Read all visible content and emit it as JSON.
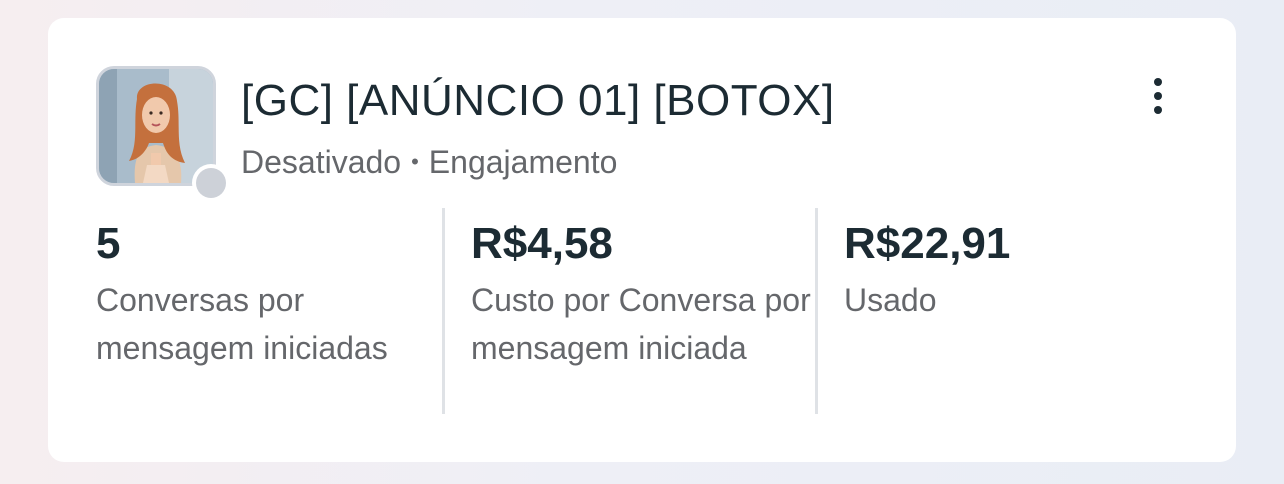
{
  "ad": {
    "title": "[GC] [ANÚNCIO 01] [BOTOX]",
    "status": "Desativado",
    "separator": "•",
    "objective": "Engajamento",
    "thumbnail_icon": "ad-video-thumbnail",
    "more_icon": "more-vertical-icon"
  },
  "metrics": [
    {
      "value": "5",
      "label": "Conversas por mensagem iniciadas"
    },
    {
      "value": "R$4,58",
      "label": "Custo por Conversa por mensagem iniciada"
    },
    {
      "value": "R$22,91",
      "label": "Usado"
    }
  ],
  "colors": {
    "text_primary": "#1c2b33",
    "text_secondary": "#65676b",
    "status_inactive": "#cdd1d8"
  }
}
